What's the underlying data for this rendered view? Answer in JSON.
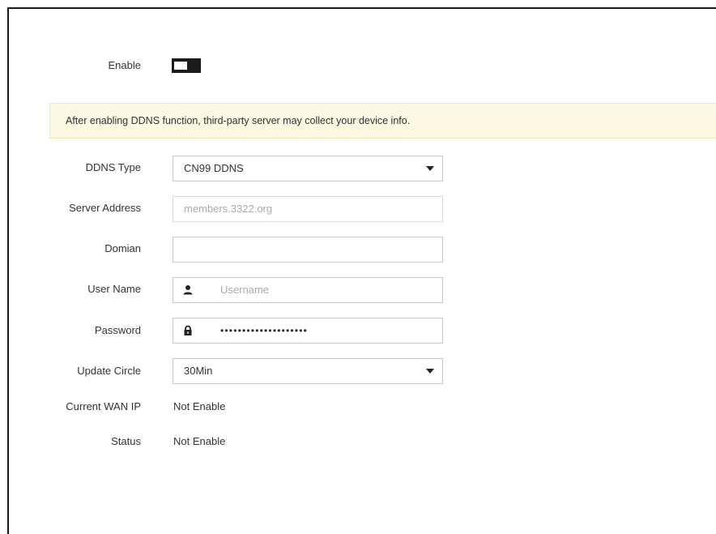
{
  "form": {
    "enable_label": "Enable",
    "enable_on": false,
    "notice": "After enabling DDNS function, third-party server may collect your device info.",
    "ddns_type_label": "DDNS Type",
    "ddns_type_value": "CN99 DDNS",
    "server_address_label": "Server Address",
    "server_address_value": "members.3322.org",
    "domain_label": "Domian",
    "domain_value": "",
    "username_label": "User Name",
    "username_placeholder": "Username",
    "password_label": "Password",
    "password_value": "••••••••••••••••••••",
    "update_circle_label": "Update Circle",
    "update_circle_value": "30Min",
    "wan_ip_label": "Current WAN IP",
    "wan_ip_value": "Not Enable",
    "status_label": "Status",
    "status_value": "Not Enable"
  },
  "icons": {
    "user": "user-icon",
    "lock": "lock-icon",
    "dropdown": "chevron-down-icon"
  }
}
